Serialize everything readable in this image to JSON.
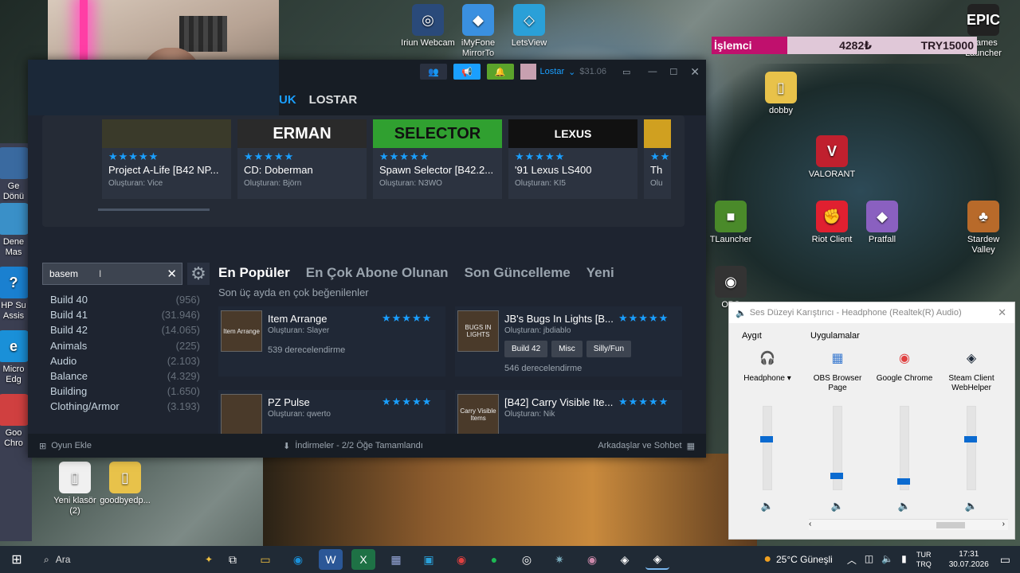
{
  "desktop": {
    "icons_top": [
      {
        "label": "Iriun Webcam",
        "glyph": "◎",
        "color": "#2a4a7a"
      },
      {
        "label": "iMyFone MirrorTo",
        "glyph": "◆",
        "color": "#3a90e0"
      },
      {
        "label": "LetsView",
        "glyph": "◇",
        "color": "#2aa0d8"
      }
    ],
    "icons_right": [
      {
        "label": "Games\nLauncher",
        "glyph": "EPIC",
        "color": "#222"
      },
      {
        "label": "dobby",
        "glyph": "▯",
        "color": "#e8c24a"
      },
      {
        "label": "VALORANT",
        "glyph": "V",
        "color": "#c0202e"
      },
      {
        "label": "TLauncher",
        "glyph": "■",
        "color": "#4a8a2a"
      },
      {
        "label": "Riot Client",
        "glyph": "✊",
        "color": "#e02030"
      },
      {
        "label": "Pratfall",
        "glyph": "◆",
        "color": "#8a60c0"
      },
      {
        "label": "Stardew\nValley",
        "glyph": "♣",
        "color": "#b86a2a"
      },
      {
        "label": "OBS",
        "glyph": "◉",
        "color": "#333"
      }
    ],
    "icons_left": [
      {
        "label": "Ge\nDönü",
        "glyph": "",
        "color": "#3a6aa0"
      },
      {
        "label": "Dene\nMas",
        "glyph": "",
        "color": "#3a90c8"
      },
      {
        "label": "HP Su\nAssis",
        "glyph": "?",
        "color": "#1a80d0"
      },
      {
        "label": "Micro\nEdg",
        "glyph": "e",
        "color": "#1a90d8"
      },
      {
        "label": "Goo\nChro",
        "glyph": "",
        "color": "#d04040"
      }
    ],
    "icons_bottom": [
      {
        "label": "Yeni klasör\n(2)",
        "glyph": "▯",
        "color": "#f0f0f0"
      },
      {
        "label": "goodbyedp...",
        "glyph": "▯",
        "color": "#e8c24a"
      }
    ]
  },
  "banner": {
    "label": "İşlemci",
    "value1": "4282₺",
    "value2": "TRY15000"
  },
  "steam": {
    "titlebar": {
      "username": "Lostar",
      "balance": "$31.06"
    },
    "nav": {
      "partial": "UK",
      "profile": "LOSTAR"
    },
    "carousel": [
      {
        "thumb": "",
        "title": "Project A-Life [B42 NP...",
        "author": "Oluşturan: Vice",
        "stars": "★★★★★",
        "thumb_color": "#3a3a2a",
        "thumb_text_color": "#fff"
      },
      {
        "thumb": "ERMAN",
        "title": "CD: Doberman",
        "author": "Oluşturan: Björn",
        "stars": "★★★★★",
        "thumb_color": "#2a2a2a",
        "thumb_text_color": "#fff"
      },
      {
        "thumb": "SELECTOR",
        "title": "Spawn Selector [B42.2...",
        "author": "Oluşturan: N3WO",
        "stars": "★★★★★",
        "thumb_color": "#30a030",
        "thumb_text_color": "#111"
      },
      {
        "thumb": "LEXUS",
        "title": "'91 Lexus LS400",
        "author": "Oluşturan: KI5",
        "stars": "★★★★★",
        "thumb_color": "#111",
        "thumb_text_color": "#fff"
      },
      {
        "thumb": "",
        "title": "Th",
        "author": "Olu",
        "stars": "★★",
        "thumb_color": "#d0a020",
        "thumb_text_color": "#fff"
      }
    ],
    "search": {
      "value": "basem"
    },
    "filters": [
      {
        "label": "Build 40",
        "count": "(956)"
      },
      {
        "label": "Build 41",
        "count": "(31.946)"
      },
      {
        "label": "Build 42",
        "count": "(14.065)"
      },
      {
        "label": "Animals",
        "count": "(225)"
      },
      {
        "label": "Audio",
        "count": "(2.103)"
      },
      {
        "label": "Balance",
        "count": "(4.329)"
      },
      {
        "label": "Building",
        "count": "(1.650)"
      },
      {
        "label": "Clothing/Armor",
        "count": "(3.193)"
      }
    ],
    "tabs": [
      "En Popüler",
      "En Çok Abone Olunan",
      "Son Güncelleme",
      "Yeni"
    ],
    "subtitle": "Son üç ayda en çok beğenilenler",
    "items": [
      {
        "name": "Item Arrange",
        "author": "Oluşturan: Slayer",
        "ratings": "539 derecelendirme",
        "stars": "★★★★★",
        "thumb": "Item Arrange"
      },
      {
        "name": "JB's Bugs In Lights [B...",
        "author": "Oluşturan: jbdiablo",
        "ratings": "546 derecelendirme",
        "stars": "★★★★★",
        "thumb": "BUGS IN LIGHTS",
        "tags": [
          "Build 42",
          "Misc",
          "Silly/Fun"
        ]
      },
      {
        "name": "PZ Pulse",
        "author": "Oluşturan: qwerto",
        "stars": "★★★★★",
        "thumb": ""
      },
      {
        "name": "[B42] Carry Visible Ite...",
        "author": "Oluşturan: Nik",
        "stars": "★★★★★",
        "thumb": "Carry Visible Items"
      }
    ],
    "footer": {
      "add_game": "Oyun Ekle",
      "downloads": "İndirmeler - 2/2 Öğe Tamamlandı",
      "friends": "Arkadaşlar ve Sohbet"
    }
  },
  "mixer": {
    "title": "Ses Düzeyi Karıştırıcı - Headphone (Realtek(R) Audio)",
    "device_header": "Aygıt",
    "apps_header": "Uygulamalar",
    "columns": [
      {
        "label": "Headphone ▾",
        "glyph": "🎧",
        "color": "#333",
        "level": 0.62
      },
      {
        "label": "OBS Browser Page",
        "glyph": "▦",
        "color": "#3a7ad0",
        "level": 0.15
      },
      {
        "label": "Google Chrome",
        "glyph": "◉",
        "color": "#e04040",
        "level": 0.08
      },
      {
        "label": "Steam Client WebHelper",
        "glyph": "◈",
        "color": "#1b2838",
        "level": 0.62
      }
    ]
  },
  "taskbar": {
    "search": "Ara",
    "weather": "25°C Güneşli",
    "lang1": "TUR",
    "lang2": "TRQ",
    "time": "17:31",
    "date": "30.07.2026"
  }
}
